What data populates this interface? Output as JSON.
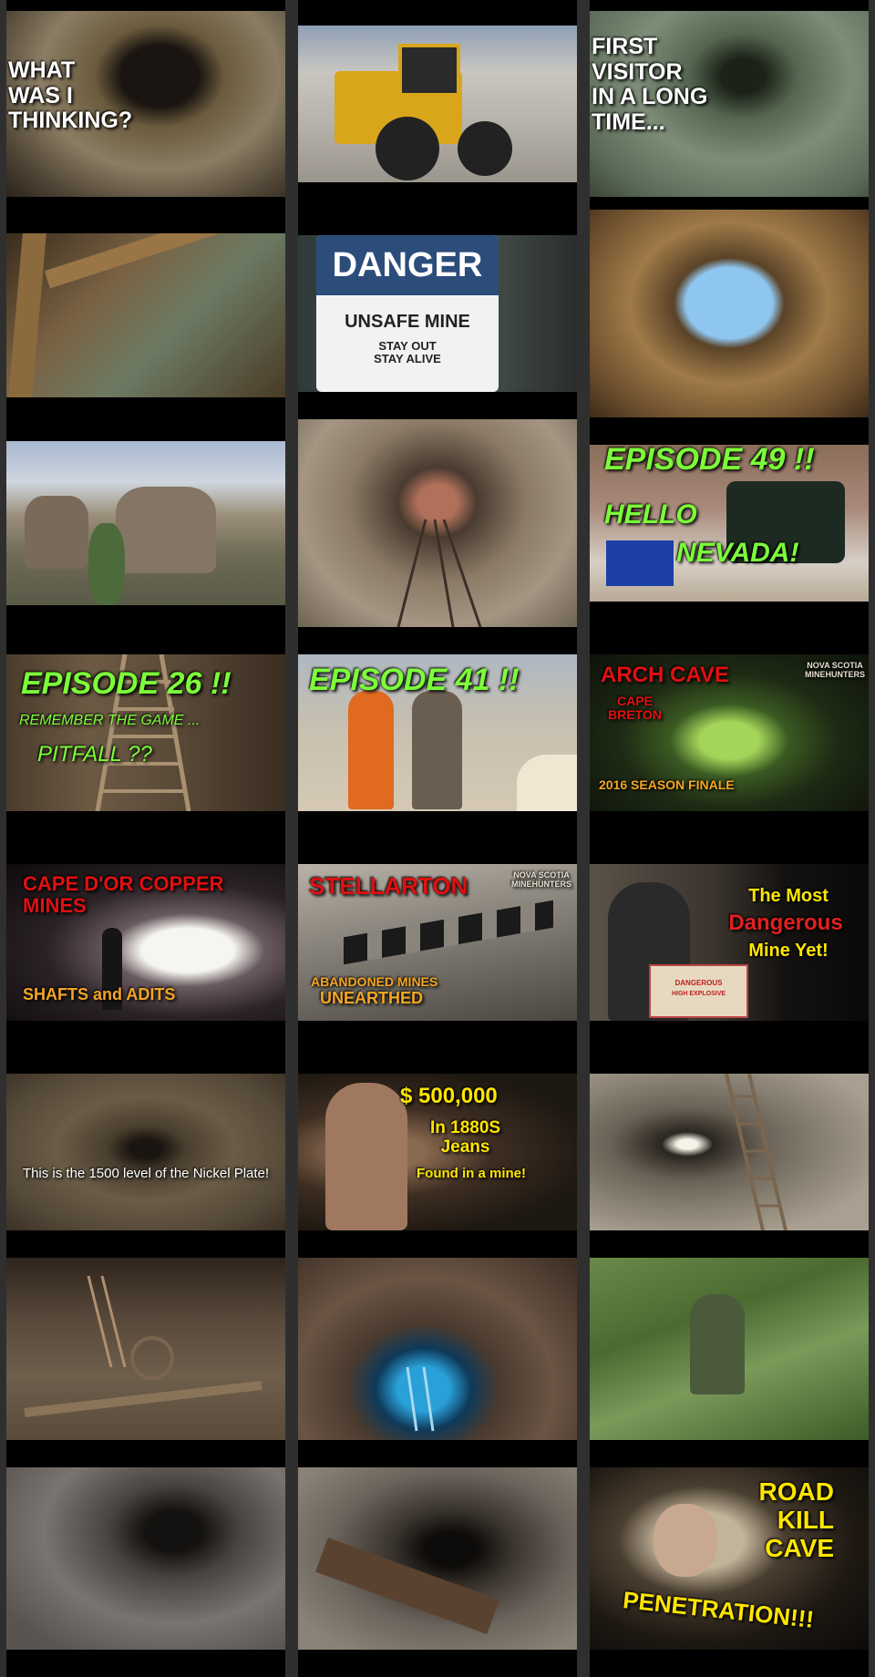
{
  "videos": [
    {
      "caption": "WHAT\nWAS I\nTHINKING?",
      "style": "white"
    },
    {
      "caption": "",
      "style": ""
    },
    {
      "caption": "FIRST\nVISITOR\nIN A LONG\nTIME...",
      "style": "white"
    },
    {
      "caption": "",
      "style": ""
    },
    {
      "caption": "DANGER",
      "sub1": "UNSAFE MINE",
      "sub2": "STAY OUT\nSTAY ALIVE",
      "style": "sign"
    },
    {
      "caption": "",
      "style": ""
    },
    {
      "caption": "",
      "style": ""
    },
    {
      "caption": "",
      "style": ""
    },
    {
      "caption": "EPISODE 49 !!",
      "sub1": "HELLO",
      "sub2": "NEVADA!",
      "style": "green"
    },
    {
      "caption": "EPISODE 26 !!",
      "sub1": "REMEMBER THE GAME ...",
      "sub2": "PITFALL ??",
      "style": "green"
    },
    {
      "caption": "EPISODE 41 !!",
      "style": "green"
    },
    {
      "caption": "ARCH CAVE",
      "sub1": "CAPE\nBRETON",
      "sub2": "2016 SEASON FINALE",
      "brand": "NOVA SCOTIA\nMINEHUNTERS",
      "style": "red"
    },
    {
      "caption": "CAPE D'OR COPPER MINES",
      "sub2": "SHAFTS and ADITS",
      "style": "red"
    },
    {
      "caption": "STELLARTON",
      "sub1": "ABANDONED MINES",
      "sub2": "UNEARTHED",
      "brand": "NOVA SCOTIA\nMINEHUNTERS",
      "style": "red"
    },
    {
      "caption": "The Most",
      "sub1": "Dangerous",
      "sub2": "Mine Yet!",
      "box1": "DANGEROUS",
      "box2": "HIGH EXPLOSIVE",
      "style": "yellow"
    },
    {
      "caption": "This is the 1500 level of the Nickel Plate!",
      "style": "plain"
    },
    {
      "caption": "$ 500,000",
      "sub1": "In 1880S\nJeans",
      "sub2": "Found in a mine!",
      "style": "yellow"
    },
    {
      "caption": "",
      "style": ""
    },
    {
      "caption": "",
      "style": ""
    },
    {
      "caption": "",
      "style": ""
    },
    {
      "caption": "",
      "style": ""
    },
    {
      "caption": "",
      "style": ""
    },
    {
      "caption": "",
      "style": ""
    },
    {
      "caption": "ROAD\nKILL\nCAVE",
      "sub2": "PENETRATION!!!",
      "style": "yellow"
    }
  ]
}
